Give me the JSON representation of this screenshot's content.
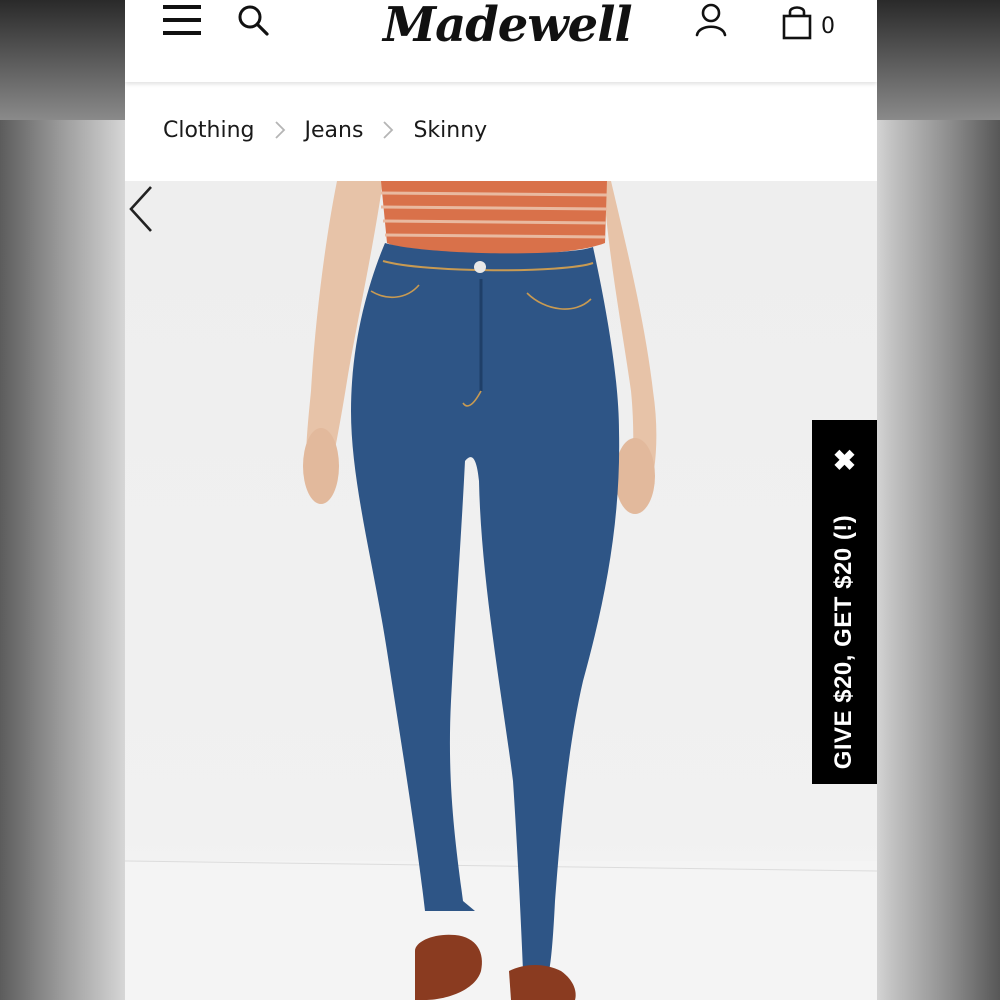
{
  "header": {
    "logo_text": "Madewell",
    "cart_count": "0",
    "icons": [
      "menu-icon",
      "search-icon",
      "account-icon",
      "shopping-bag-icon"
    ]
  },
  "breadcrumb": {
    "items": [
      "Clothing",
      "Jeans",
      "Skinny"
    ]
  },
  "product": {
    "image_description_icon": "product-photo"
  },
  "promo": {
    "text": "GIVE $20, GET $20 (!)",
    "close_glyph": "✖"
  },
  "colors": {
    "accent": "#000000",
    "denim": "#2e5586",
    "shirt": "#d9714a"
  }
}
